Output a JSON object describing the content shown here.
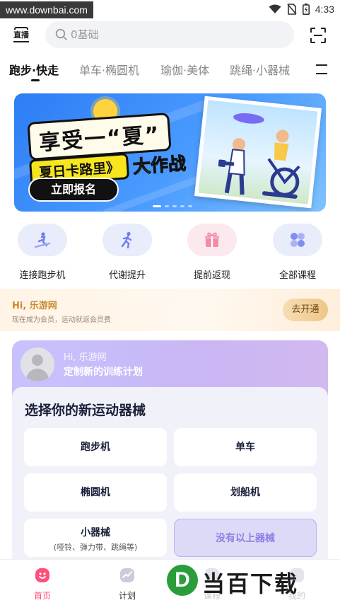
{
  "status_bar": {
    "watermark": "www.downbai.com",
    "time": "4:33"
  },
  "top_bar": {
    "live_label": "直播",
    "search_placeholder": "0基础"
  },
  "tabs": [
    {
      "label": "跑步·快走",
      "active": true
    },
    {
      "label": "单车·椭圆机",
      "active": false
    },
    {
      "label": "瑜伽·美体",
      "active": false
    },
    {
      "label": "跳绳·小器械",
      "active": false
    }
  ],
  "banner": {
    "title": "享受一“夏”",
    "subtitle": "夏日卡路里》",
    "subtitle_big": "大作战",
    "cta": "立即报名"
  },
  "quick_actions": [
    {
      "label": "连接跑步机",
      "icon": "treadmill-icon",
      "color": "#e9ecfb"
    },
    {
      "label": "代谢提升",
      "icon": "runner-icon",
      "color": "#e9ecfb"
    },
    {
      "label": "提前返现",
      "icon": "gift-icon",
      "color": "#fbe9ee"
    },
    {
      "label": "全部课程",
      "icon": "grid-icon",
      "color": "#e9ecfb"
    }
  ],
  "vip": {
    "greeting": "Hi, 乐游网",
    "description": "现在成为会员，运动就返会员费",
    "button": "去开通"
  },
  "plan": {
    "greeting": "Hi, 乐游网",
    "subtitle": "定制新的训练计划",
    "heading": "选择你的新运动器械",
    "options": [
      {
        "label": "跑步机"
      },
      {
        "label": "单车"
      },
      {
        "label": "椭圆机"
      },
      {
        "label": "划船机"
      },
      {
        "label": "小器械",
        "note": "(哑铃、弹力带、跳绳等)"
      },
      {
        "label": "没有以上器械"
      }
    ]
  },
  "bottom_nav": [
    {
      "label": "首页",
      "icon": "home-icon",
      "active": true
    },
    {
      "label": "计划",
      "icon": "plan-icon",
      "active": false
    },
    {
      "label": "课程",
      "icon": "course-icon",
      "active": false
    },
    {
      "label": "我的",
      "icon": "profile-icon",
      "active": false
    }
  ],
  "site_logo": {
    "mark": "D",
    "name": "当百下载"
  },
  "colors": {
    "accent_pink": "#ff4f7b",
    "banner_blue": "#2d7df5",
    "vip_gold": "#c9892c",
    "plan_purple": "#c7c2ff"
  }
}
